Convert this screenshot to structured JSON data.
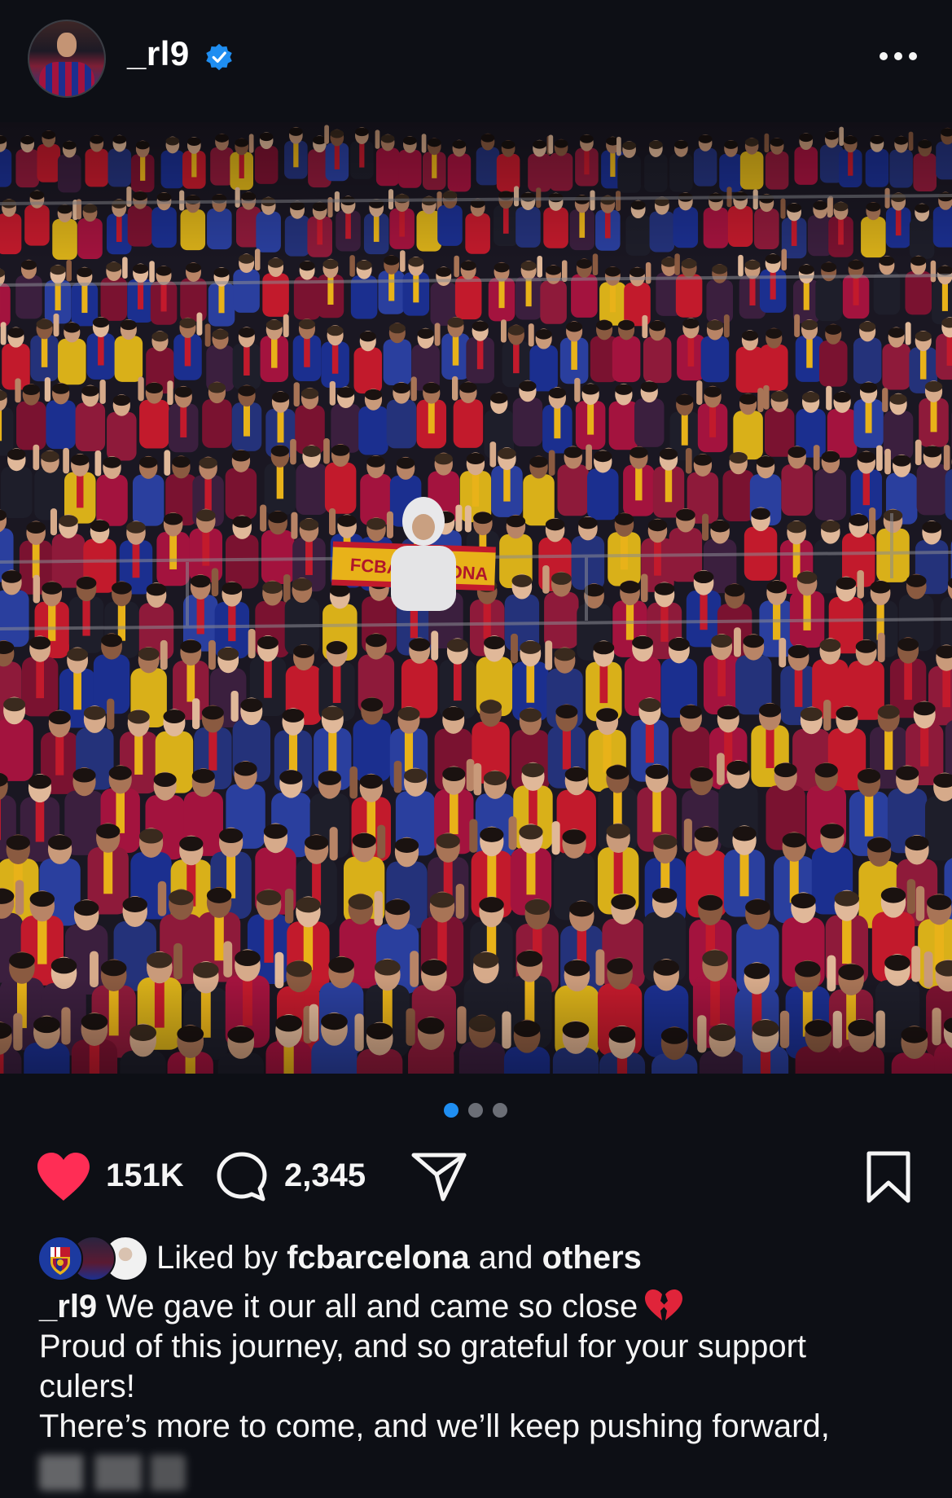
{
  "post": {
    "username": "_rl9",
    "verified": true,
    "more_icon": "more-horizontal-icon",
    "image_alt": "photo of FC Barcelona fans in the stands applauding",
    "carousel": {
      "total": 3,
      "active_index": 0
    }
  },
  "actions": {
    "likes": "151K",
    "comments": "2,345",
    "icons": [
      "heart-icon",
      "comment-icon",
      "share-icon",
      "bookmark-icon"
    ],
    "liked_color": "#ff2d55"
  },
  "liked_by": {
    "prefix": "Liked by",
    "account": "fcbarcelona",
    "conjunction": "and",
    "others": "others"
  },
  "caption": {
    "handle": "_rl9",
    "line1": "We gave it our all and came so close",
    "line2": "Proud of this journey, and so grateful for your support",
    "line3": "culers!",
    "line4": "There’s more to come, and we’ll keep pushing forward,"
  },
  "colors": {
    "background": "#0d0f15",
    "verified_blue": "#1f8ef1",
    "dot_active": "#1f8ef1",
    "dot_inactive": "#6b6e76"
  }
}
